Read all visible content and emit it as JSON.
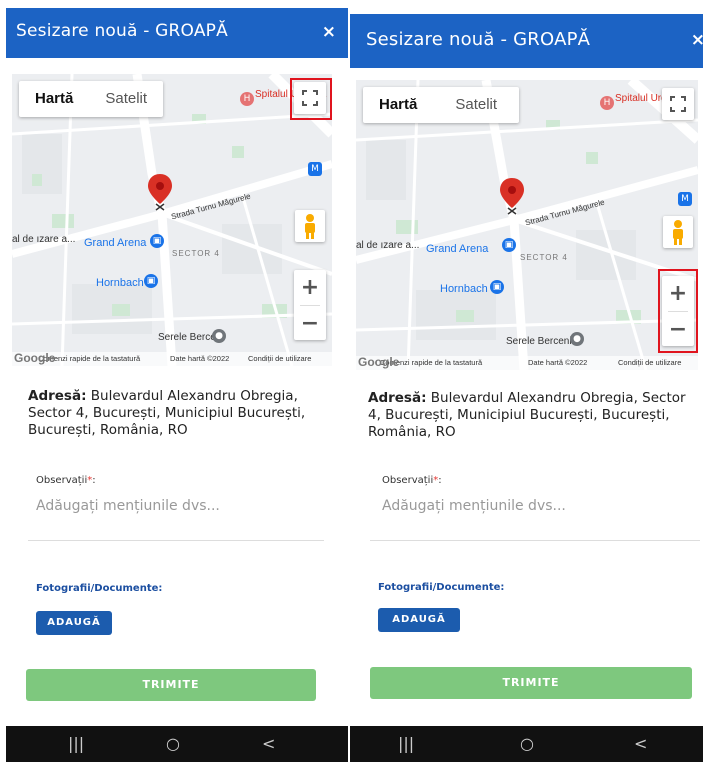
{
  "screens": [
    {
      "header": {
        "title": "Sesizare nouă - GROAPĂ",
        "close": "×"
      },
      "map": {
        "types": [
          "Hartă",
          "Satelit"
        ],
        "labels": {
          "grand_arena": "Grand Arena",
          "sector": "SECTOR 4",
          "hornbach": "Hornbach",
          "serele": "Serele Berceni",
          "street": "Strada Turnu Măgurele",
          "spital": "Spitalul Urgență",
          "left_cut": "al de ızare a..."
        },
        "footer": {
          "logo": "Google",
          "shortcuts": "Comenzi rapide de la tastatură",
          "mapdata": "Date hartă ©2022",
          "terms": "Condiții de utilizare"
        },
        "zoom_in": "+",
        "zoom_out": "−"
      },
      "address": {
        "label": "Adresă:",
        "value": "Bulevardul Alexandru Obregia, Sector 4, București, Municipiul București, București, România, RO"
      },
      "observations": {
        "label": "Observații",
        "required": "*",
        "suffix": ":",
        "placeholder": "Adăugați mențiunile dvs..."
      },
      "documents": {
        "label": "Fotografii/Documente:",
        "add": "ADAUGĂ"
      },
      "submit": "TRIMITE",
      "nav": {
        "recents": "|||",
        "home": "○",
        "back": "<"
      },
      "highlight": "fullscreen"
    },
    {
      "header": {
        "title": "Sesizare nouă - GROAPĂ",
        "close": "×"
      },
      "map": {
        "types": [
          "Hartă",
          "Satelit"
        ],
        "labels": {
          "grand_arena": "Grand Arena",
          "sector": "SECTOR 4",
          "hornbach": "Hornbach",
          "serele": "Serele Berceni",
          "street": "Strada Turnu Măgurele",
          "spital": "Spitalul Urgență",
          "left_cut": "al de ızare a..."
        },
        "footer": {
          "logo": "Google",
          "shortcuts": "Comenzi rapide de la tastatură",
          "mapdata": "Date hartă ©2022",
          "terms": "Condiții de utilizare"
        },
        "zoom_in": "+",
        "zoom_out": "−"
      },
      "address": {
        "label": "Adresă:",
        "value": "Bulevardul Alexandru Obregia, Sector 4, București, Municipiul București, București, România, RO"
      },
      "observations": {
        "label": "Observații",
        "required": "*",
        "suffix": ":",
        "placeholder": "Adăugați mențiunile dvs..."
      },
      "documents": {
        "label": "Fotografii/Documente:",
        "add": "ADAUGĂ"
      },
      "submit": "TRIMITE",
      "nav": {
        "recents": "|||",
        "home": "○",
        "back": "<"
      },
      "highlight": "zoom"
    }
  ],
  "colors": {
    "appbar": "#1c63c4",
    "submit": "#7ec87e",
    "add": "#1c5cae",
    "highlight": "#e0141e",
    "pin": "#d93025"
  }
}
